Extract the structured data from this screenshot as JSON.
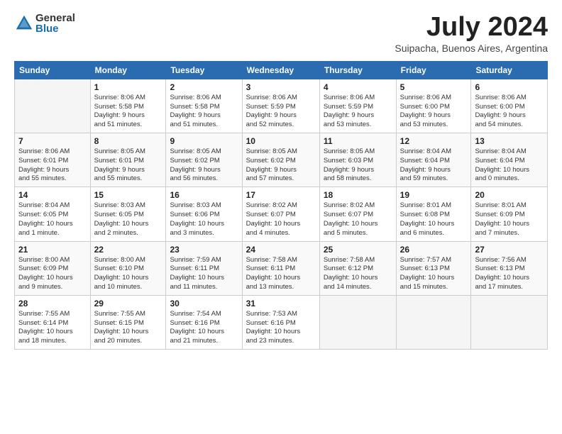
{
  "logo": {
    "general": "General",
    "blue": "Blue"
  },
  "title": "July 2024",
  "subtitle": "Suipacha, Buenos Aires, Argentina",
  "headers": [
    "Sunday",
    "Monday",
    "Tuesday",
    "Wednesday",
    "Thursday",
    "Friday",
    "Saturday"
  ],
  "weeks": [
    [
      {
        "date": "",
        "info": ""
      },
      {
        "date": "1",
        "info": "Sunrise: 8:06 AM\nSunset: 5:58 PM\nDaylight: 9 hours\nand 51 minutes."
      },
      {
        "date": "2",
        "info": "Sunrise: 8:06 AM\nSunset: 5:58 PM\nDaylight: 9 hours\nand 51 minutes."
      },
      {
        "date": "3",
        "info": "Sunrise: 8:06 AM\nSunset: 5:59 PM\nDaylight: 9 hours\nand 52 minutes."
      },
      {
        "date": "4",
        "info": "Sunrise: 8:06 AM\nSunset: 5:59 PM\nDaylight: 9 hours\nand 53 minutes."
      },
      {
        "date": "5",
        "info": "Sunrise: 8:06 AM\nSunset: 6:00 PM\nDaylight: 9 hours\nand 53 minutes."
      },
      {
        "date": "6",
        "info": "Sunrise: 8:06 AM\nSunset: 6:00 PM\nDaylight: 9 hours\nand 54 minutes."
      }
    ],
    [
      {
        "date": "7",
        "info": "Sunrise: 8:06 AM\nSunset: 6:01 PM\nDaylight: 9 hours\nand 55 minutes."
      },
      {
        "date": "8",
        "info": "Sunrise: 8:05 AM\nSunset: 6:01 PM\nDaylight: 9 hours\nand 55 minutes."
      },
      {
        "date": "9",
        "info": "Sunrise: 8:05 AM\nSunset: 6:02 PM\nDaylight: 9 hours\nand 56 minutes."
      },
      {
        "date": "10",
        "info": "Sunrise: 8:05 AM\nSunset: 6:02 PM\nDaylight: 9 hours\nand 57 minutes."
      },
      {
        "date": "11",
        "info": "Sunrise: 8:05 AM\nSunset: 6:03 PM\nDaylight: 9 hours\nand 58 minutes."
      },
      {
        "date": "12",
        "info": "Sunrise: 8:04 AM\nSunset: 6:04 PM\nDaylight: 9 hours\nand 59 minutes."
      },
      {
        "date": "13",
        "info": "Sunrise: 8:04 AM\nSunset: 6:04 PM\nDaylight: 10 hours\nand 0 minutes."
      }
    ],
    [
      {
        "date": "14",
        "info": "Sunrise: 8:04 AM\nSunset: 6:05 PM\nDaylight: 10 hours\nand 1 minute."
      },
      {
        "date": "15",
        "info": "Sunrise: 8:03 AM\nSunset: 6:05 PM\nDaylight: 10 hours\nand 2 minutes."
      },
      {
        "date": "16",
        "info": "Sunrise: 8:03 AM\nSunset: 6:06 PM\nDaylight: 10 hours\nand 3 minutes."
      },
      {
        "date": "17",
        "info": "Sunrise: 8:02 AM\nSunset: 6:07 PM\nDaylight: 10 hours\nand 4 minutes."
      },
      {
        "date": "18",
        "info": "Sunrise: 8:02 AM\nSunset: 6:07 PM\nDaylight: 10 hours\nand 5 minutes."
      },
      {
        "date": "19",
        "info": "Sunrise: 8:01 AM\nSunset: 6:08 PM\nDaylight: 10 hours\nand 6 minutes."
      },
      {
        "date": "20",
        "info": "Sunrise: 8:01 AM\nSunset: 6:09 PM\nDaylight: 10 hours\nand 7 minutes."
      }
    ],
    [
      {
        "date": "21",
        "info": "Sunrise: 8:00 AM\nSunset: 6:09 PM\nDaylight: 10 hours\nand 9 minutes."
      },
      {
        "date": "22",
        "info": "Sunrise: 8:00 AM\nSunset: 6:10 PM\nDaylight: 10 hours\nand 10 minutes."
      },
      {
        "date": "23",
        "info": "Sunrise: 7:59 AM\nSunset: 6:11 PM\nDaylight: 10 hours\nand 11 minutes."
      },
      {
        "date": "24",
        "info": "Sunrise: 7:58 AM\nSunset: 6:11 PM\nDaylight: 10 hours\nand 13 minutes."
      },
      {
        "date": "25",
        "info": "Sunrise: 7:58 AM\nSunset: 6:12 PM\nDaylight: 10 hours\nand 14 minutes."
      },
      {
        "date": "26",
        "info": "Sunrise: 7:57 AM\nSunset: 6:13 PM\nDaylight: 10 hours\nand 15 minutes."
      },
      {
        "date": "27",
        "info": "Sunrise: 7:56 AM\nSunset: 6:13 PM\nDaylight: 10 hours\nand 17 minutes."
      }
    ],
    [
      {
        "date": "28",
        "info": "Sunrise: 7:55 AM\nSunset: 6:14 PM\nDaylight: 10 hours\nand 18 minutes."
      },
      {
        "date": "29",
        "info": "Sunrise: 7:55 AM\nSunset: 6:15 PM\nDaylight: 10 hours\nand 20 minutes."
      },
      {
        "date": "30",
        "info": "Sunrise: 7:54 AM\nSunset: 6:16 PM\nDaylight: 10 hours\nand 21 minutes."
      },
      {
        "date": "31",
        "info": "Sunrise: 7:53 AM\nSunset: 6:16 PM\nDaylight: 10 hours\nand 23 minutes."
      },
      {
        "date": "",
        "info": ""
      },
      {
        "date": "",
        "info": ""
      },
      {
        "date": "",
        "info": ""
      }
    ]
  ]
}
